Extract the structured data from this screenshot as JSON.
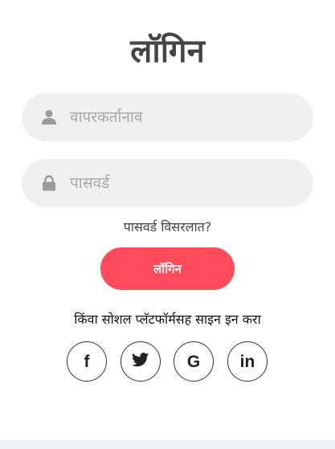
{
  "login": {
    "title": "लॉगिन",
    "username_placeholder": "वापरकर्तानाव",
    "password_placeholder": "पासवर्ड",
    "forgot_password": "पासवर्ड विसरलात?",
    "login_button": "लॉगिन",
    "social_text": "किंवा सोशल प्लॅटफॉर्मसह साइन इन करा"
  },
  "social": {
    "facebook_glyph": "f",
    "google_glyph": "G",
    "linkedin_glyph": "in"
  },
  "icons": {
    "username": "user-icon",
    "password": "lock-icon",
    "facebook": "facebook-icon",
    "twitter": "twitter-icon",
    "google": "google-icon",
    "linkedin": "linkedin-icon"
  },
  "colors": {
    "accent": "#ff4b5c",
    "field_background": "#f0f0f0",
    "placeholder": "#a8a8a8",
    "footer_strip": "#eef2f7"
  }
}
